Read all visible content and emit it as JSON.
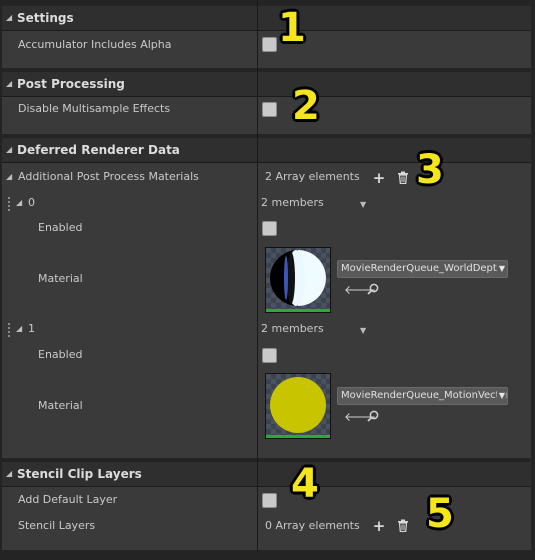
{
  "categories": {
    "settings": {
      "label": "Settings",
      "arrow": "◢"
    },
    "post_processing": {
      "label": "Post Processing",
      "arrow": "◢"
    },
    "deferred": {
      "label": "Deferred Renderer Data",
      "arrow": "◢"
    },
    "stencil": {
      "label": "Stencil Clip Layers",
      "arrow": "◢"
    }
  },
  "settings": {
    "accumulator_label": "Accumulator Includes Alpha",
    "accumulator_checked": false
  },
  "post_processing": {
    "disable_msaa_label": "Disable Multisample Effects",
    "disable_msaa_checked": false
  },
  "deferred": {
    "materials_label": "Additional Post Process Materials",
    "materials_count": "2 Array elements",
    "elements": [
      {
        "index": "0",
        "members": "2 members",
        "enabled_label": "Enabled",
        "enabled_checked": false,
        "material_label": "Material",
        "material_asset": "MovieRenderQueue_WorldDepth"
      },
      {
        "index": "1",
        "members": "2 members",
        "enabled_label": "Enabled",
        "enabled_checked": false,
        "material_label": "Material",
        "material_asset": "MovieRenderQueue_MotionVectors"
      }
    ]
  },
  "stencil": {
    "add_default_label": "Add Default Layer",
    "add_default_checked": false,
    "layers_label": "Stencil Layers",
    "layers_count": "0 Array elements"
  },
  "icons": {
    "add": "+",
    "delete": "trash-icon",
    "use_selected": "arrow-left-icon",
    "browse": "search-icon"
  },
  "callouts": [
    "1",
    "2",
    "3",
    "4",
    "5"
  ],
  "colors": {
    "callout_yellow": "#f5e51c",
    "thumb_green_bar": "#2fa83a",
    "motion_vector_yellow": "#c8c400"
  }
}
